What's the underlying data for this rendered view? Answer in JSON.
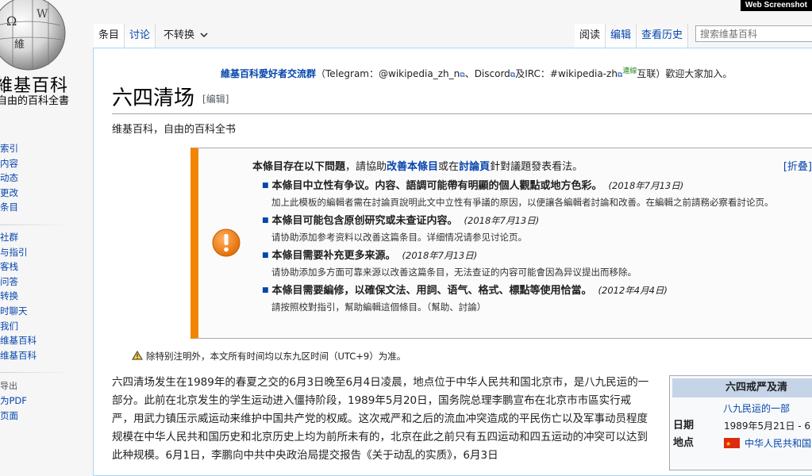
{
  "watermark": "Web Screenshot",
  "logo": {
    "wordmark": "維基百科",
    "tagline": "自由的百科全書",
    "globe_letters": [
      "Ω",
      "維",
      "W"
    ]
  },
  "leftnav": {
    "group1": [
      "索引",
      "内容",
      "动态",
      "更改",
      "条目"
    ],
    "group2": [
      "社群",
      "与指引",
      "客栈",
      "问答",
      "转换",
      "时聊天",
      "我们",
      "维基百科",
      "维基百科"
    ],
    "group3_heading": "导出",
    "group3": [
      "为PDF",
      "页面"
    ]
  },
  "tabs": {
    "left": [
      "条目",
      "讨论"
    ],
    "variant": "不转换",
    "right": [
      "阅读",
      "编辑",
      "查看历史"
    ]
  },
  "search": {
    "placeholder": "搜索维基百科"
  },
  "sitenotice": {
    "group": "維基百科愛好者交流群",
    "text1": "（Telegram：@wikipedia_zh_n",
    "text2": "、Discord",
    "text3": "及IRC：#wikipedia-zh",
    "tag": "連線",
    "text4": "互联）歡迎大家加入。"
  },
  "page": {
    "title": "六四清场",
    "edit_label": "[编辑]",
    "subtitle": "维基百科，自由的百科全书"
  },
  "ambox": {
    "head_prefix": "本條目存在以下問題",
    "head_mid1": "，請協助",
    "head_link1": "改善本條目",
    "head_mid2": "或在",
    "head_link2": "討論頁",
    "head_suffix": "針對議題發表看法。",
    "collapse": "[折叠]",
    "issues": [
      {
        "main": "本條目中立性有争议。内容、語調可能帶有明顯的個人觀點或地方色彩。",
        "date": "(2018年7月13日)",
        "note": "加上此模板的編輯者需在討論頁說明此文中立性有爭議的原因，以便讓各編輯者討論和改善。在編輯之前請務必察看討论页。"
      },
      {
        "main": "本條目可能包含原创研究或未查证内容。",
        "date": "(2018年7月13日)",
        "note": "请协助添加参考资料以改善这篇条目。详细情况请参见讨论页。"
      },
      {
        "main": "本條目需要补充更多来源。",
        "date": "(2018年7月13日)",
        "note": "请协助添加多方面可靠来源以改善这篇条目，无法查证的内容可能會因為异议提出而移除。"
      },
      {
        "main": "本條目需要編修，以確保文法、用詞、语气、格式、標點等使用恰當。",
        "date": "(2012年4月4日)",
        "note": "請按照校對指引，幫助編輯這個條目。（幫助、討論）"
      }
    ]
  },
  "tznote": "除特别注明外，本文所有时间均以东九区时间（UTC+9）为准。",
  "paragraph": "六四清场发生在1989年的春夏之交的6月3日晚至6月4日凌晨，地点位于中华人民共和国北京市，是八九民运的一部分。此前在北京发生的学生运动进入僵持阶段，1989年5月20日，国务院总理李鹏宣布在北京市市區实行戒严，用武力镇压示威运动来维护中国共产党的权威。这次戒严和之后的流血冲突造成的平民伤亡以及军事动员程度规模在中华人民共和国历史和北京历史上均为前所未有的，北京在此之前只有五四运动和四五运动的冲突可以达到此种规模。6月1日，李鹏向中共中央政治局提交报告《关于动乱的实质》，6月3日",
  "infobox": {
    "title": "六四戒严及清",
    "subtitle": "八九民运的一部",
    "rows": [
      {
        "key": "日期",
        "value": "1989年5月21日 - 6"
      },
      {
        "key": "地点",
        "value": "中华人民共和国"
      }
    ]
  }
}
